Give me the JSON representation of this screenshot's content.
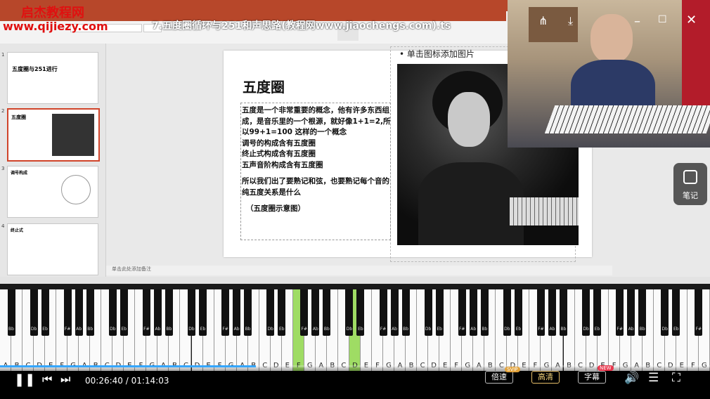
{
  "watermark": {
    "line1": "启杰教程网",
    "line2": "www.qijiezy.com"
  },
  "video_title": "7.五度圈循环与251和声思路(教程网www.jiaochengs.com).ts",
  "slides": [
    {
      "num": "1",
      "title": "五度圈与251进行"
    },
    {
      "num": "2",
      "title": "五度圈"
    },
    {
      "num": "3",
      "title": "调号构成"
    },
    {
      "num": "4",
      "title": "终止式"
    }
  ],
  "slide": {
    "title": "五度圈",
    "body": [
      "五度是一个非常重要的概念，他有许多东西组成，是音乐里的一个根源，就好像1+1=2,所以99+1=100 这样的一个概念",
      "调号的构成含有五度圈",
      "终止式构成含有五度圈",
      "五声音阶构成含有五度圈",
      "",
      "所以我们出了要熟记和弦，也要熟记每个音的纯五度关系是什么",
      "",
      "（五度圈示意图）"
    ],
    "image_placeholder": "单击图标添加图片"
  },
  "notes_placeholder": "单击此处添加备注",
  "note_button": "笔记",
  "piano": {
    "white_labels": [
      "A",
      "B",
      "C",
      "D",
      "E",
      "F",
      "G",
      "A",
      "B",
      "C",
      "D",
      "E",
      "F",
      "G",
      "A",
      "B",
      "C",
      "D",
      "E",
      "F",
      "G",
      "A",
      "B",
      "C",
      "D",
      "E",
      "F",
      "G",
      "A",
      "B",
      "C",
      "D",
      "E",
      "F",
      "G",
      "A",
      "B",
      "C",
      "D",
      "E",
      "F",
      "G",
      "A",
      "B",
      "C",
      "D",
      "E",
      "F",
      "G",
      "A",
      "B",
      "C",
      "D",
      "E",
      "F",
      "G",
      "A",
      "B",
      "C",
      "D",
      "E",
      "F",
      "G"
    ],
    "black_labels": [
      "Bb",
      "Db",
      "Eb",
      "F#",
      "Ab",
      "Bb",
      "Db",
      "Eb",
      "F#",
      "Ab",
      "Bb",
      "Db",
      "Eb",
      "F#",
      "Ab",
      "Bb",
      "Db",
      "Eb",
      "F#",
      "Ab",
      "Bb",
      "Db",
      "Eb",
      "F#",
      "Ab",
      "Bb",
      "Db",
      "Eb",
      "F#",
      "Ab",
      "Bb",
      "Db",
      "Eb",
      "F#",
      "Ab",
      "Bb",
      "Db",
      "Eb",
      "F#",
      "Ab",
      "Bb",
      "Db",
      "Eb",
      "F#",
      "Ab"
    ],
    "active_white": [
      26,
      31
    ]
  },
  "player": {
    "current": "00:26:40",
    "separator": " / ",
    "total": "01:14:03",
    "progress": 0.36,
    "speed_label": "倍速",
    "speed_badge": "SVIP",
    "quality_label": "高清",
    "subtitle_label": "字幕",
    "subtitle_badge": "NEW"
  },
  "colors": {
    "accent": "#b7472a",
    "progress": "#35a7ff",
    "key_active": "#9fdc64"
  }
}
